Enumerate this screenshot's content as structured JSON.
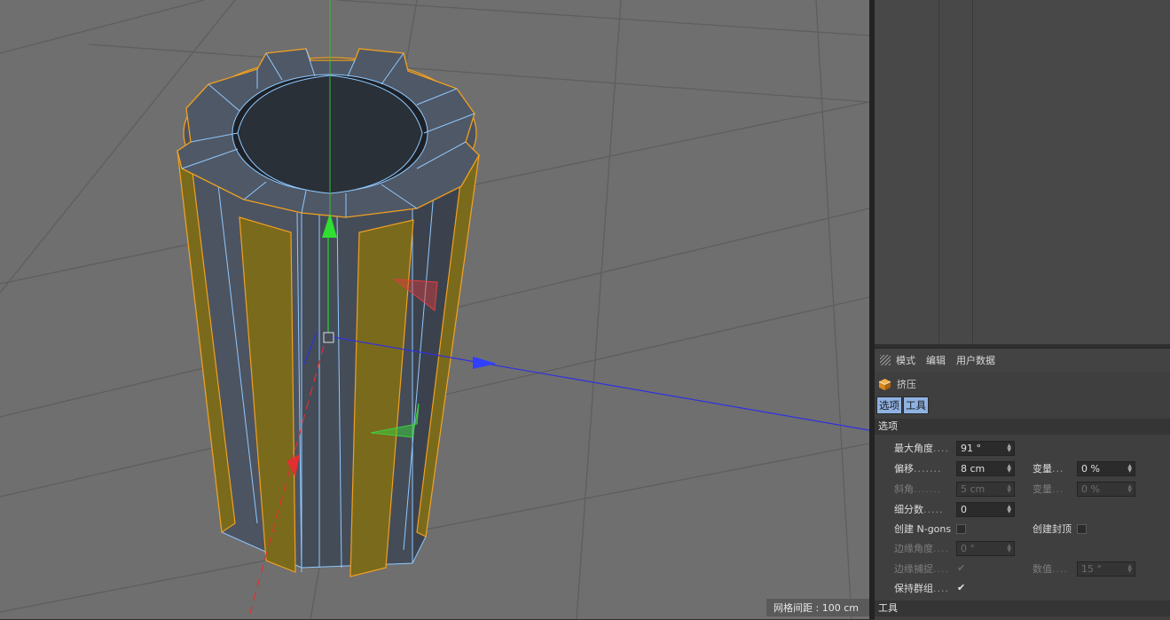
{
  "viewport": {
    "grid_spacing": "网格间距 : 100 cm"
  },
  "attributes": {
    "menu": [
      "模式",
      "编辑",
      "用户数据"
    ],
    "object_name": "挤压",
    "tabs": [
      {
        "label": "选项",
        "active": true
      },
      {
        "label": "工具",
        "active": false
      }
    ],
    "section_options": "选项",
    "section_tools": "工具",
    "max_angle": {
      "label": "最大角度",
      "dots": "....",
      "value": "91 °"
    },
    "offset": {
      "label": "偏移",
      "dots": ".......",
      "value": "8 cm"
    },
    "variance1": {
      "label": "变量",
      "dots": "...",
      "value": "0 %"
    },
    "bevel": {
      "label": "斜角",
      "dots": ".......",
      "value": "5 cm"
    },
    "variance2": {
      "label": "变量",
      "dots": "...",
      "value": "0 %"
    },
    "subdivision": {
      "label": "细分数",
      "dots": ".....",
      "value": "0"
    },
    "create_ngons": {
      "label": "创建 N-gons",
      "checked": false
    },
    "create_caps": {
      "label": "创建封顶",
      "checked": false
    },
    "edge_angle": {
      "label": "边缘角度",
      "dots": "....",
      "value": "0 °"
    },
    "edge_snap": {
      "label": "边缘捕捉",
      "dots": "....",
      "checked": true,
      "check_glyph": "✔"
    },
    "value_field": {
      "label": "数值",
      "dots": "....",
      "value": "15 °"
    },
    "keep_groups": {
      "label": "保持群组",
      "dots": "....",
      "checked": true,
      "check_glyph": "✔"
    }
  },
  "colors": {
    "viewport_bg": "#6f6f6f",
    "selected_faces": "#7a6a1c",
    "selection_outline": "#f0a020",
    "mesh_edges": "#8fc8ff",
    "axis_x": "#e03030",
    "axis_y": "#30d030",
    "axis_z": "#3030e0"
  },
  "icons": [
    "grip-icon",
    "extrude-object-icon",
    "spin-arrows-icon",
    "checkmark-icon"
  ]
}
